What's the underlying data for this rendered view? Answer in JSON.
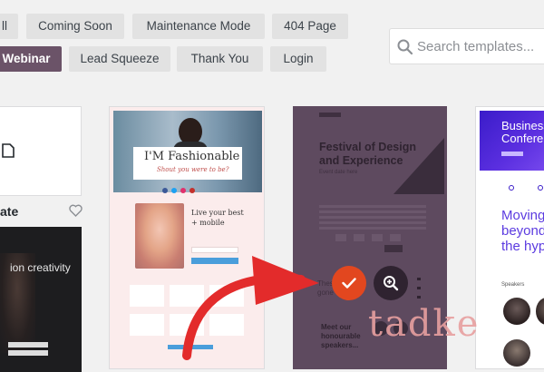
{
  "filters": {
    "row1": [
      "ll",
      "Coming Soon",
      "Maintenance Mode",
      "404 Page"
    ],
    "row2": [
      "Webinar",
      "Lead Squeeze",
      "Thank You",
      "Login"
    ],
    "active": "Webinar"
  },
  "search": {
    "placeholder": "Search templates..."
  },
  "cards": {
    "left_top": {
      "label": "ate"
    },
    "left_bottom": {
      "text": "ion creativity"
    },
    "fashion": {
      "title": "I'M Fashionable",
      "tagline": "Shout you were to be?",
      "promo_title": "Live your best",
      "promo_sub": "+ mobile"
    },
    "festival": {
      "title_line1": "Festival of Design",
      "title_line2": "and Experience",
      "subtitle": "Event date here",
      "speakers_line1": "Meet our",
      "speakers_line2": "honourable",
      "speakers_line3": "speakers...",
      "left_text1": "Thes",
      "left_text2": "gone"
    },
    "business": {
      "title_line1": "Business",
      "title_line2": "Confere",
      "body_line1": "Moving",
      "body_line2": "beyond",
      "body_line3": "the hyp",
      "speakers_label": "Speakers"
    }
  },
  "actions": {
    "select_icon": "check-icon",
    "preview_icon": "magnifier-plus-icon"
  },
  "watermark": "tadke",
  "colors": {
    "accent_purple": "#6b5368",
    "check_orange": "#e2471f",
    "arrow_red": "#e32b2b",
    "festival_bg": "#5e4a5f"
  }
}
